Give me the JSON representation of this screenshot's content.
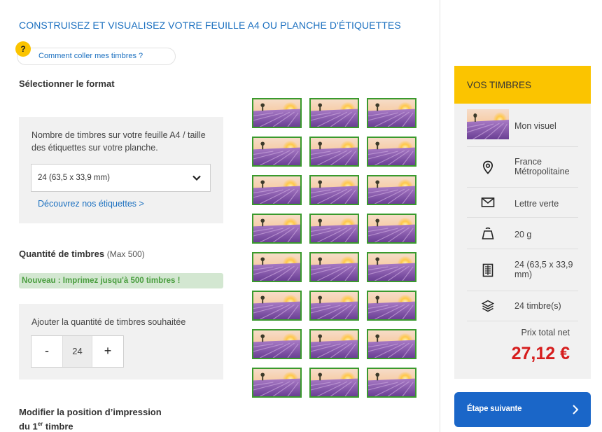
{
  "header": {
    "title": "CONSTRUISEZ ET VISUALISEZ VOTRE FEUILLE A4 OU PLANCHE D'ÉTIQUETTES",
    "help_badge": "?",
    "help_link": "Comment coller mes timbres ?"
  },
  "format": {
    "title": "Sélectionner le format",
    "description": "Nombre de timbres sur votre feuille A4 / taille des étiquettes sur votre planche.",
    "selected": "24 (63,5 x 33,9 mm)",
    "discover_link": "Découvrez nos étiquettes >"
  },
  "quantity": {
    "title": "Quantité de timbres",
    "max_note": "(Max 500)",
    "banner": "Nouveau : Imprimez jusqu'à 500 timbres !",
    "label": "Ajouter la quantité de timbres souhaitée",
    "minus": "-",
    "value": "24",
    "plus": "+"
  },
  "position": {
    "title_line1": "Modifier la position d’impression",
    "title_line2_prefix": "du 1",
    "title_line2_sup": "er",
    "title_line2_suffix": " timbre"
  },
  "sheet": {
    "rows": 8,
    "cols": 3,
    "image": "lavender-field-sunset"
  },
  "summary": {
    "title": "VOS TIMBRES",
    "visual": "Mon visuel",
    "destination": "France Métropolitaine",
    "service": "Lettre verte",
    "weight": "20 g",
    "format": "24 (63,5 x 33,9 mm)",
    "count": "24 timbre(s)",
    "price_label": "Prix total net",
    "price": "27,12 €",
    "icons": [
      "location-pin-icon",
      "envelope-icon",
      "weight-icon",
      "sheet-icon",
      "layers-icon"
    ]
  },
  "actions": {
    "next": "Étape suivante"
  },
  "colors": {
    "accent_blue": "#1a6fbf",
    "button_blue": "#1a66c8",
    "yellow": "#fbc400",
    "stamp_border": "#3a9a2d",
    "price_red": "#d61d1d",
    "banner_green": "#4a9e3f"
  }
}
